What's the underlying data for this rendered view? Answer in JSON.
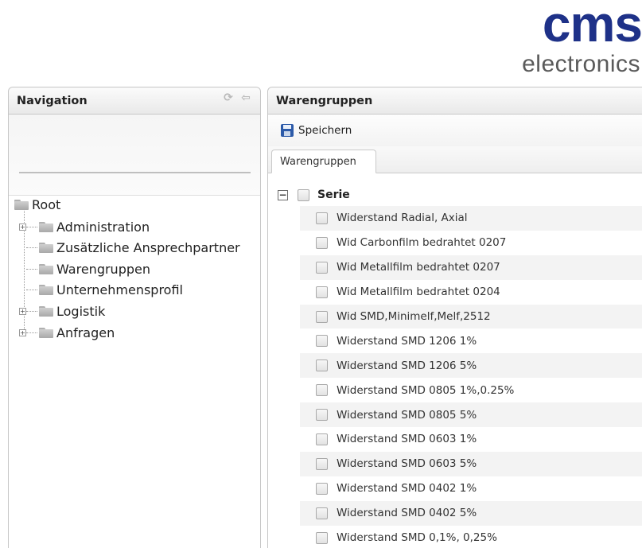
{
  "logo": {
    "primary": "cms",
    "secondary": "electronics",
    "brand_color": "#1e3188"
  },
  "navigation": {
    "title": "Navigation",
    "tools": [
      "refresh-icon",
      "collapse-icon"
    ],
    "tree": {
      "root": "Root",
      "items": [
        {
          "label": "Administration",
          "expandable": true
        },
        {
          "label": "Zusätzliche Ansprechpartner",
          "expandable": false
        },
        {
          "label": "Warengruppen",
          "expandable": false
        },
        {
          "label": "Unternehmensprofil",
          "expandable": false
        },
        {
          "label": "Logistik",
          "expandable": true
        },
        {
          "label": "Anfragen",
          "expandable": true
        }
      ]
    }
  },
  "main": {
    "title": "Warengruppen",
    "toolbar": {
      "save_label": "Speichern"
    },
    "tabs": [
      {
        "label": "Warengruppen",
        "active": true
      }
    ],
    "group": {
      "label": "Serie",
      "items": [
        "Widerstand Radial, Axial",
        "Wid Carbonfilm bedrahtet 0207",
        "Wid Metallfilm bedrahtet 0207",
        "Wid Metallfilm bedrahtet 0204",
        "Wid SMD,Minimelf,Melf,2512",
        "Widerstand SMD 1206 1%",
        "Widerstand SMD 1206 5%",
        "Widerstand SMD 0805 1%,0.25%",
        "Widerstand SMD 0805 5%",
        "Widerstand SMD 0603 1%",
        "Widerstand SMD 0603 5%",
        "Widerstand SMD 0402 1%",
        "Widerstand SMD 0402 5%",
        "Widerstand SMD 0,1%, 0,25%"
      ]
    }
  }
}
